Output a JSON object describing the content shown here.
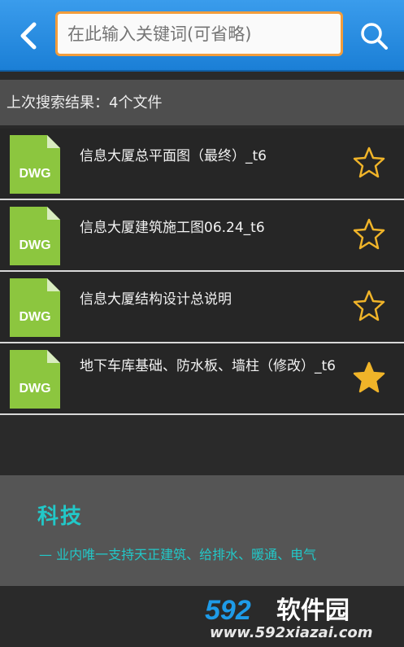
{
  "colors": {
    "topbar": "#1b7fd6",
    "search_border": "#f29d3c",
    "star": "#f0b429",
    "accent_text": "#22c8c8",
    "file_icon": "#8cc63f"
  },
  "topbar": {
    "back_icon": "chevron-left-icon",
    "search_placeholder": "在此输入关键词(可省略)",
    "search_icon": "search-icon"
  },
  "results": {
    "title": "上次搜索结果：4个文件"
  },
  "files": [
    {
      "type_label": "DWG",
      "name": "信息大厦总平面图（最终）_t6",
      "favorited": false
    },
    {
      "type_label": "DWG",
      "name": "信息大厦建筑施工图06.24_t6",
      "favorited": false
    },
    {
      "type_label": "DWG",
      "name": "信息大厦结构设计总说明",
      "favorited": false
    },
    {
      "type_label": "DWG",
      "name": "地下车库基础、防水板、墙柱（修改）_t6",
      "favorited": true
    }
  ],
  "banner": {
    "title": "科技",
    "subtitle": "— 业内唯一支持天正建筑、给排水、暖通、电气"
  },
  "watermark": {
    "logo": "592软件园",
    "url": "www.592xiazai.com"
  }
}
